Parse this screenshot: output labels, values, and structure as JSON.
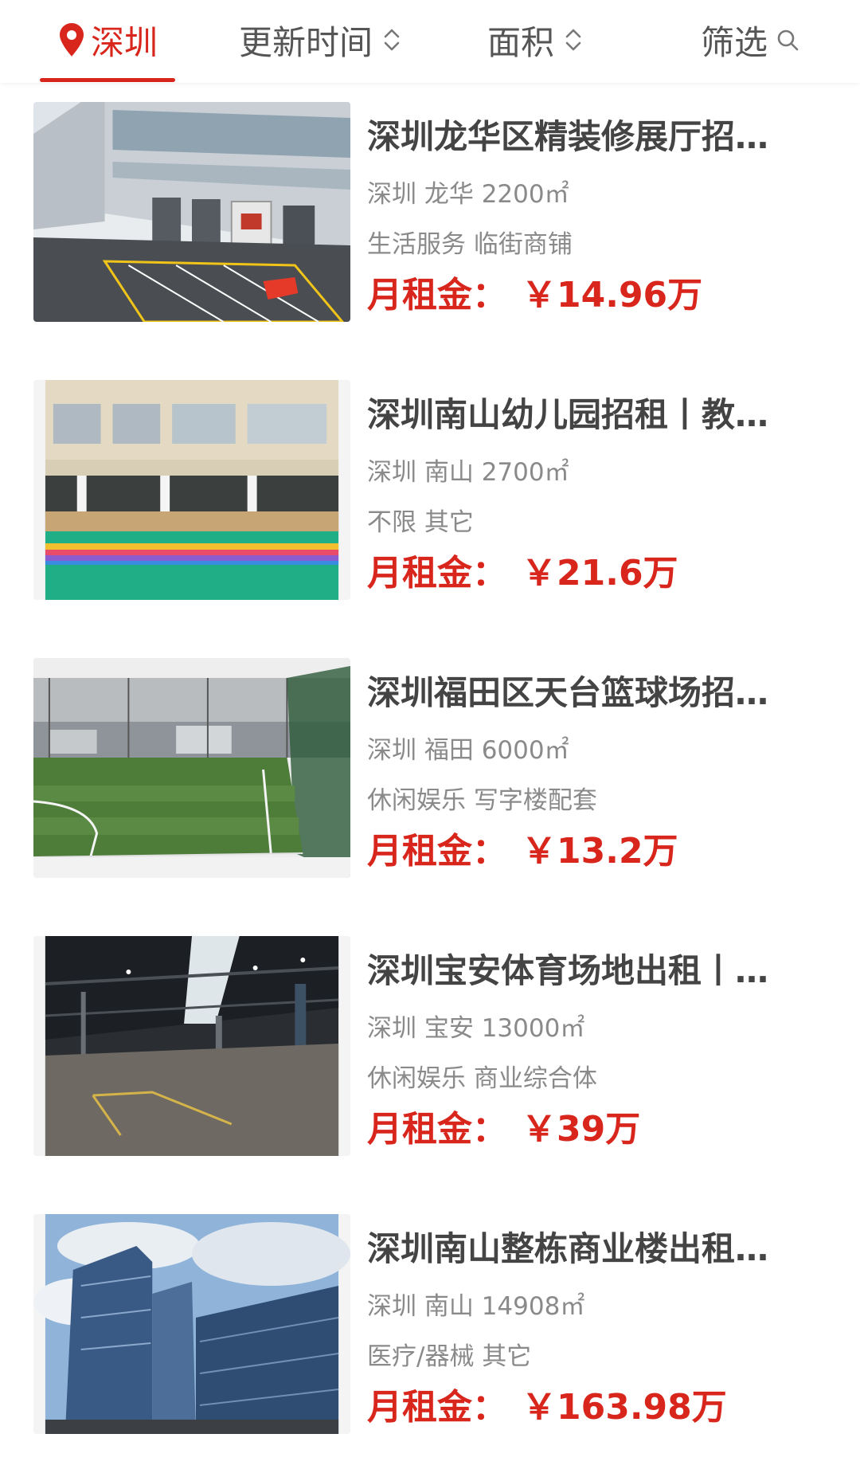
{
  "filter_bar": {
    "city": "深圳",
    "update_time": "更新时间",
    "area": "面积",
    "filter": "筛选"
  },
  "colors": {
    "accent": "#d9261c",
    "title": "#444444",
    "meta": "#8a8a8a"
  },
  "listings": [
    {
      "title": "深圳龙华区精装修展厅招…",
      "meta": "深圳 龙华 2200㎡",
      "tags": "生活服务 临街商铺",
      "price_label": "月租金：",
      "price": "￥14.96万"
    },
    {
      "title": "深圳南山幼儿园招租丨教…",
      "meta": "深圳 南山 2700㎡",
      "tags": "不限 其它",
      "price_label": "月租金：",
      "price": "￥21.6万"
    },
    {
      "title": "深圳福田区天台篮球场招…",
      "meta": "深圳 福田 6000㎡",
      "tags": "休闲娱乐 写字楼配套",
      "price_label": "月租金：",
      "price": "￥13.2万"
    },
    {
      "title": "深圳宝安体育场地出租丨…",
      "meta": "深圳 宝安 13000㎡",
      "tags": "休闲娱乐 商业综合体",
      "price_label": "月租金：",
      "price": "￥39万"
    },
    {
      "title": "深圳南山整栋商业楼出租…",
      "meta": "深圳 南山 14908㎡",
      "tags": "医疗/器械 其它",
      "price_label": "月租金：",
      "price": "￥163.98万"
    }
  ]
}
